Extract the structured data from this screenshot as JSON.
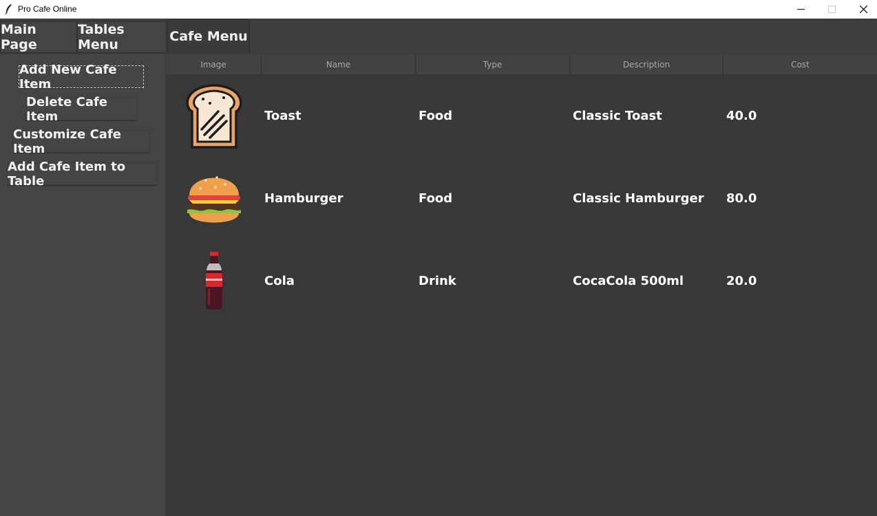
{
  "window": {
    "title": "Pro Cafe Online"
  },
  "tabs": [
    {
      "label": "Main Page"
    },
    {
      "label": "Tables Menu"
    },
    {
      "label": "Cafe Menu"
    }
  ],
  "sidebar": {
    "buttons": [
      {
        "label": "Add New Cafe Item"
      },
      {
        "label": "Delete Cafe Item"
      },
      {
        "label": "Customize Cafe Item"
      },
      {
        "label": "Add Cafe Item to Table"
      }
    ]
  },
  "table": {
    "columns": [
      "Image",
      "Name",
      "Type",
      "Description",
      "Cost"
    ],
    "rows": [
      {
        "image": "toast-icon",
        "name": "Toast",
        "type": "Food",
        "description": "Classic Toast",
        "cost": "40.0"
      },
      {
        "image": "hamburger-icon",
        "name": "Hamburger",
        "type": "Food",
        "description": "Classic Hamburger",
        "cost": "80.0"
      },
      {
        "image": "cola-bottle-icon",
        "name": "Cola",
        "type": "Drink",
        "description": "CocaCola 500ml",
        "cost": "20.0"
      }
    ]
  },
  "colors": {
    "background": "#383838",
    "sidebar": "#444444",
    "text": "#ffffff",
    "header_text": "#a7a7a7"
  }
}
